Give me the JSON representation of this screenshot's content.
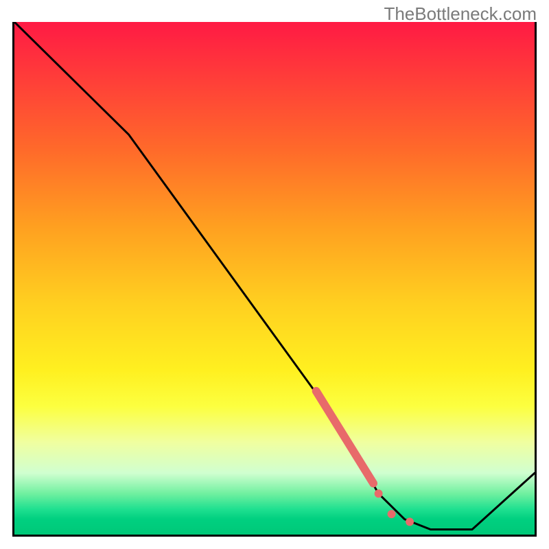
{
  "watermark": "TheBottleneck.com",
  "chart_data": {
    "type": "line",
    "title": "",
    "xlabel": "",
    "ylabel": "",
    "xlim": [
      0,
      100
    ],
    "ylim": [
      0,
      100
    ],
    "background": "red-yellow-green vertical gradient",
    "series": [
      {
        "name": "bottleneck-curve",
        "color": "#000000",
        "points": [
          {
            "x": 0,
            "y": 100
          },
          {
            "x": 22,
            "y": 78
          },
          {
            "x": 62,
            "y": 22
          },
          {
            "x": 70,
            "y": 8
          },
          {
            "x": 75,
            "y": 3
          },
          {
            "x": 80,
            "y": 1
          },
          {
            "x": 88,
            "y": 1
          },
          {
            "x": 100,
            "y": 12
          }
        ]
      }
    ],
    "highlight_segment": {
      "color": "#e86a6a",
      "points": [
        {
          "x": 58,
          "y": 28
        },
        {
          "x": 69,
          "y": 10
        }
      ],
      "dots": [
        {
          "x": 70,
          "y": 8
        },
        {
          "x": 72.5,
          "y": 4
        },
        {
          "x": 76,
          "y": 2.5
        }
      ]
    }
  }
}
